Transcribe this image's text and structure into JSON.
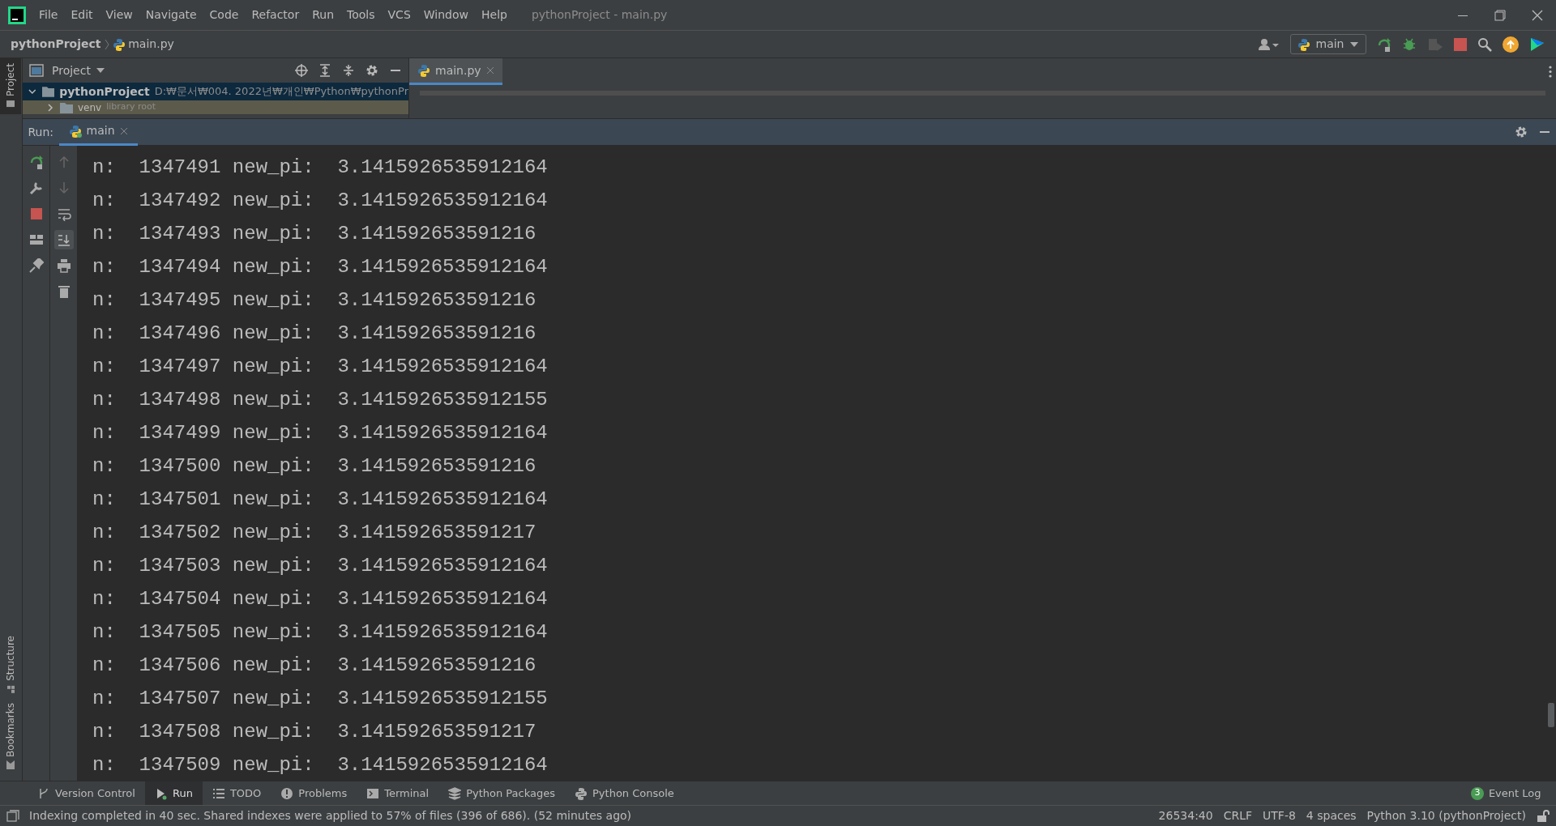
{
  "window": {
    "title": "pythonProject - main.py"
  },
  "menu": [
    "File",
    "Edit",
    "View",
    "Navigate",
    "Code",
    "Refactor",
    "Run",
    "Tools",
    "VCS",
    "Window",
    "Help"
  ],
  "breadcrumb": [
    "pythonProject",
    "main.py"
  ],
  "run_config": "main",
  "side_tabs": {
    "top": [
      {
        "label": "Project",
        "selected": true
      }
    ],
    "bottom": [
      {
        "label": "Structure",
        "selected": false
      },
      {
        "label": "Bookmarks",
        "selected": false
      }
    ]
  },
  "project_panel": {
    "title": "Project",
    "tree": [
      {
        "label": "pythonProject",
        "path": "D:₩문서₩004. 2022년₩개인₩Python₩pythonPr",
        "expanded": true,
        "selected": true,
        "children": [
          {
            "label": "venv",
            "note": "library root",
            "expanded": false,
            "selected": false
          }
        ]
      }
    ]
  },
  "editor_tabs": [
    {
      "label": "main.py",
      "selected": true
    }
  ],
  "run_panel": {
    "label": "Run:",
    "tabs": [
      {
        "label": "main",
        "selected": true
      }
    ],
    "console": [
      "n:  1347491 new_pi:  3.1415926535912164",
      "n:  1347492 new_pi:  3.1415926535912164",
      "n:  1347493 new_pi:  3.141592653591216",
      "n:  1347494 new_pi:  3.1415926535912164",
      "n:  1347495 new_pi:  3.141592653591216",
      "n:  1347496 new_pi:  3.141592653591216",
      "n:  1347497 new_pi:  3.1415926535912164",
      "n:  1347498 new_pi:  3.1415926535912155",
      "n:  1347499 new_pi:  3.1415926535912164",
      "n:  1347500 new_pi:  3.141592653591216",
      "n:  1347501 new_pi:  3.1415926535912164",
      "n:  1347502 new_pi:  3.141592653591217",
      "n:  1347503 new_pi:  3.1415926535912164",
      "n:  1347504 new_pi:  3.1415926535912164",
      "n:  1347505 new_pi:  3.1415926535912164",
      "n:  1347506 new_pi:  3.141592653591216",
      "n:  1347507 new_pi:  3.1415926535912155",
      "n:  1347508 new_pi:  3.141592653591217",
      "n:  1347509 new_pi:  3.1415926535912164"
    ]
  },
  "bottom_tools": [
    {
      "label": "Version Control",
      "selected": false
    },
    {
      "label": "Run",
      "selected": true
    },
    {
      "label": "TODO",
      "selected": false
    },
    {
      "label": "Problems",
      "selected": false
    },
    {
      "label": "Terminal",
      "selected": false
    },
    {
      "label": "Python Packages",
      "selected": false
    },
    {
      "label": "Python Console",
      "selected": false
    }
  ],
  "event_log": {
    "count": "3",
    "label": "Event Log"
  },
  "status_bar": {
    "message": "Indexing completed in 40 sec. Shared indexes were applied to 57% of files (396 of 686). (52 minutes ago)",
    "items": [
      "26534:40",
      "CRLF",
      "UTF-8",
      "4 spaces",
      "Python 3.10 (pythonProject)"
    ]
  }
}
